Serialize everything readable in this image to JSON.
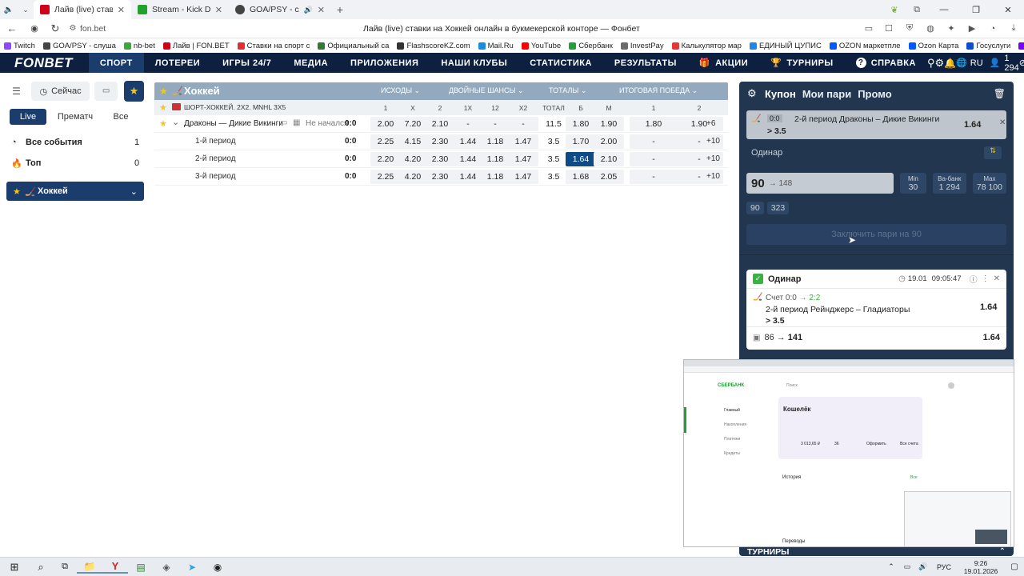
{
  "browser": {
    "tabs": [
      {
        "title": "Лайв (live) ставки на Х",
        "color": "#d0021b",
        "active": true
      },
      {
        "title": "Stream - Kick Dashb",
        "color": "#23a12f",
        "active": false
      },
      {
        "title": "GOA/PSY - слушать",
        "color": "#444444",
        "active": false
      }
    ],
    "new_tab": "+",
    "url": "fon.bet",
    "page_title": "Лайв (live) ставки на Хоккей онлайн в букмекерской конторе — Фонбет",
    "bookmarks": [
      {
        "label": "Twitch",
        "color": "#9146ff"
      },
      {
        "label": "GOA/PSY - слуша",
        "color": "#444444"
      },
      {
        "label": "nb-bet",
        "color": "#3aa83a"
      },
      {
        "label": "Лайв | FON.BET",
        "color": "#d0021b"
      },
      {
        "label": "Ставки на спорт с",
        "color": "#e03030"
      },
      {
        "label": "Официальный са",
        "color": "#2e7d32"
      },
      {
        "label": "FlashscoreKZ.com",
        "color": "#333333"
      },
      {
        "label": "Mail.Ru",
        "color": "#168de2"
      },
      {
        "label": "YouTube",
        "color": "#ff0000"
      },
      {
        "label": "Сбербанк",
        "color": "#21a038"
      },
      {
        "label": "InvestPay",
        "color": "#6b6b6b"
      },
      {
        "label": "Калькулятор мар",
        "color": "#e53935"
      },
      {
        "label": "ЕДИНЫЙ ЦУПИС",
        "color": "#1e88e5"
      },
      {
        "label": "OZON маркетпле",
        "color": "#005bff"
      },
      {
        "label": "Ozon Карта",
        "color": "#005bff"
      },
      {
        "label": "Госуслуги",
        "color": "#0d4cd3"
      },
      {
        "label": "Ростелеком",
        "color": "#7700ff"
      },
      {
        "label": "DNS – интер",
        "color": "#fc8507"
      }
    ]
  },
  "nav": {
    "logo": "FONBET",
    "items": [
      "СПОРТ",
      "ЛОТЕРЕИ",
      "ИГРЫ 24/7",
      "МЕДИА",
      "ПРИЛОЖЕНИЯ",
      "НАШИ КЛУБЫ",
      "СТАТИСТИКА",
      "РЕЗУЛЬТАТЫ",
      "АКЦИИ",
      "ТУРНИРЫ",
      "СПРАВКА"
    ],
    "lang": "RU",
    "balance": "1 294"
  },
  "left": {
    "now_label": "Сейчас",
    "filters": [
      "Live",
      "Прематч",
      "Все"
    ],
    "all_events": {
      "label": "Все события",
      "count": "1"
    },
    "top": {
      "label": "Топ",
      "count": "0"
    },
    "sport": "Хоккей"
  },
  "table": {
    "sport": "Хоккей",
    "groups": [
      "ИСХОДЫ",
      "ДВОЙНЫЕ ШАНСЫ",
      "ТОТАЛЫ",
      "ИТОГОВАЯ ПОБЕДА"
    ],
    "league": "ШОРТ-ХОККЕЙ. 2Х2. MNHL 3X5",
    "columns": [
      "1",
      "X",
      "2",
      "1X",
      "12",
      "X2",
      "ТОТАЛ",
      "Б",
      "М",
      "1",
      "2"
    ],
    "match": {
      "name": "Драконы — Дикие Викинги",
      "status": "Не начался",
      "score": "0:0",
      "odds": [
        "2.00",
        "7.20",
        "2.10",
        "-",
        "-",
        "-",
        "11.5",
        "1.80",
        "1.90",
        "1.80",
        "1.90"
      ],
      "more": "+6"
    },
    "periods": [
      {
        "name": "1-й период",
        "score": "0:0",
        "odds": [
          "2.25",
          "4.15",
          "2.30",
          "1.44",
          "1.18",
          "1.47",
          "3.5",
          "1.70",
          "2.00",
          "-",
          "-"
        ],
        "more": "+10"
      },
      {
        "name": "2-й период",
        "score": "0:0",
        "odds": [
          "2.20",
          "4.20",
          "2.30",
          "1.44",
          "1.18",
          "1.47",
          "3.5",
          "1.64",
          "2.10",
          "-",
          "-"
        ],
        "more": "+10"
      },
      {
        "name": "3-й период",
        "score": "0:0",
        "odds": [
          "2.25",
          "4.20",
          "2.30",
          "1.44",
          "1.18",
          "1.47",
          "3.5",
          "1.68",
          "2.05",
          "-",
          "-"
        ],
        "more": "+10"
      }
    ]
  },
  "coupon": {
    "tabs": [
      "Купон",
      "Мои пари",
      "Промо"
    ],
    "bet": {
      "score": "0:0",
      "event": "2-й период Драконы – Дикие Викинги",
      "line": "> 3.5",
      "odds": "1.64"
    },
    "type": "Одинар",
    "amount": "90",
    "amount_hint": "→ 148",
    "min": {
      "label": "Min",
      "value": "30"
    },
    "vabank": {
      "label": "Ва-банк",
      "value": "1 294"
    },
    "max": {
      "label": "Max",
      "value": "78 100"
    },
    "quick": [
      "90",
      "323"
    ],
    "submit": "Заключить пари на 90",
    "history": {
      "type": "Одинар",
      "date": "19.01",
      "time": "09:05:47",
      "score_label": "Счет 0:0",
      "score_to": "→ 2:2",
      "event": "2-й период Рейнджерс – Гладиаторы",
      "line": "> 3.5",
      "odds": "1.64",
      "stake": "86",
      "payout": "→ 141",
      "odds2": "1.64"
    },
    "tournaments": "ТУРНИРЫ"
  },
  "thumb": {
    "bank": "СБЕРБАНК",
    "search": "Поиск",
    "menu": [
      "Главный",
      "Накопления",
      "Платежи",
      "Кредиты"
    ],
    "wallet": "Кошелёк",
    "amount": "3 013,65 ₽",
    "cards": [
      "36",
      "Оформить",
      "Все счета"
    ],
    "history": "История",
    "all": "Все",
    "transfers": "Переводы"
  },
  "taskbar": {
    "time": "9:26",
    "date": "19.01.2026",
    "lang": "РУС"
  }
}
